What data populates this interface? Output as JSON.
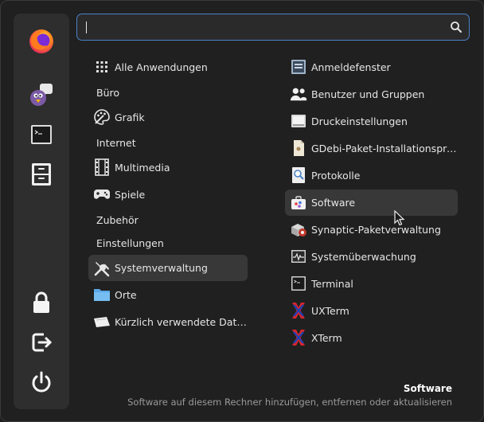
{
  "search": {
    "value": "",
    "placeholder": ""
  },
  "categories": [
    {
      "label": "Alle Anwendungen",
      "icon": "grid-icon"
    },
    {
      "label": "Büro",
      "icon": ""
    },
    {
      "label": "Grafik",
      "icon": "palette-icon"
    },
    {
      "label": "Internet",
      "icon": ""
    },
    {
      "label": "Multimedia",
      "icon": "film-icon"
    },
    {
      "label": "Spiele",
      "icon": "gamepad-icon"
    },
    {
      "label": "Zubehör",
      "icon": ""
    },
    {
      "label": "Einstellungen",
      "icon": ""
    },
    {
      "label": "Systemverwaltung",
      "icon": "tools-icon",
      "selected": true
    },
    {
      "label": "Orte",
      "icon": "folder-icon"
    },
    {
      "label": "Kürzlich verwendete Dateien",
      "icon": "recent-files-icon"
    }
  ],
  "apps": [
    {
      "label": "Anmeldefenster",
      "icon": "login-window-icon"
    },
    {
      "label": "Benutzer und Gruppen",
      "icon": "users-icon"
    },
    {
      "label": "Druckeinstellungen",
      "icon": "printer-icon"
    },
    {
      "label": "GDebi-Paket-Installationsprog…",
      "icon": "package-installer-icon"
    },
    {
      "label": "Protokolle",
      "icon": "logs-icon"
    },
    {
      "label": "Software",
      "icon": "software-icon",
      "hovered": true
    },
    {
      "label": "Synaptic-Paketverwaltung",
      "icon": "synaptic-icon"
    },
    {
      "label": "Systemüberwachung",
      "icon": "system-monitor-icon"
    },
    {
      "label": "Terminal",
      "icon": "terminal-icon"
    },
    {
      "label": "UXTerm",
      "icon": "xterm-icon"
    },
    {
      "label": "XTerm",
      "icon": "xterm-icon"
    }
  ],
  "sidebar": {
    "favorites": [
      "firefox-icon",
      "pidgin-icon",
      "terminal-icon",
      "file-cabinet-icon"
    ],
    "system": [
      "lock-icon",
      "logout-icon",
      "power-icon"
    ]
  },
  "footer": {
    "title": "Software",
    "description": "Software auf diesem Rechner hinzufügen, entfernen oder aktualisieren"
  },
  "colors": {
    "accent": "#4b82c8",
    "background": "#202020",
    "sidebar": "#2e2e2e",
    "highlight": "#383838"
  }
}
